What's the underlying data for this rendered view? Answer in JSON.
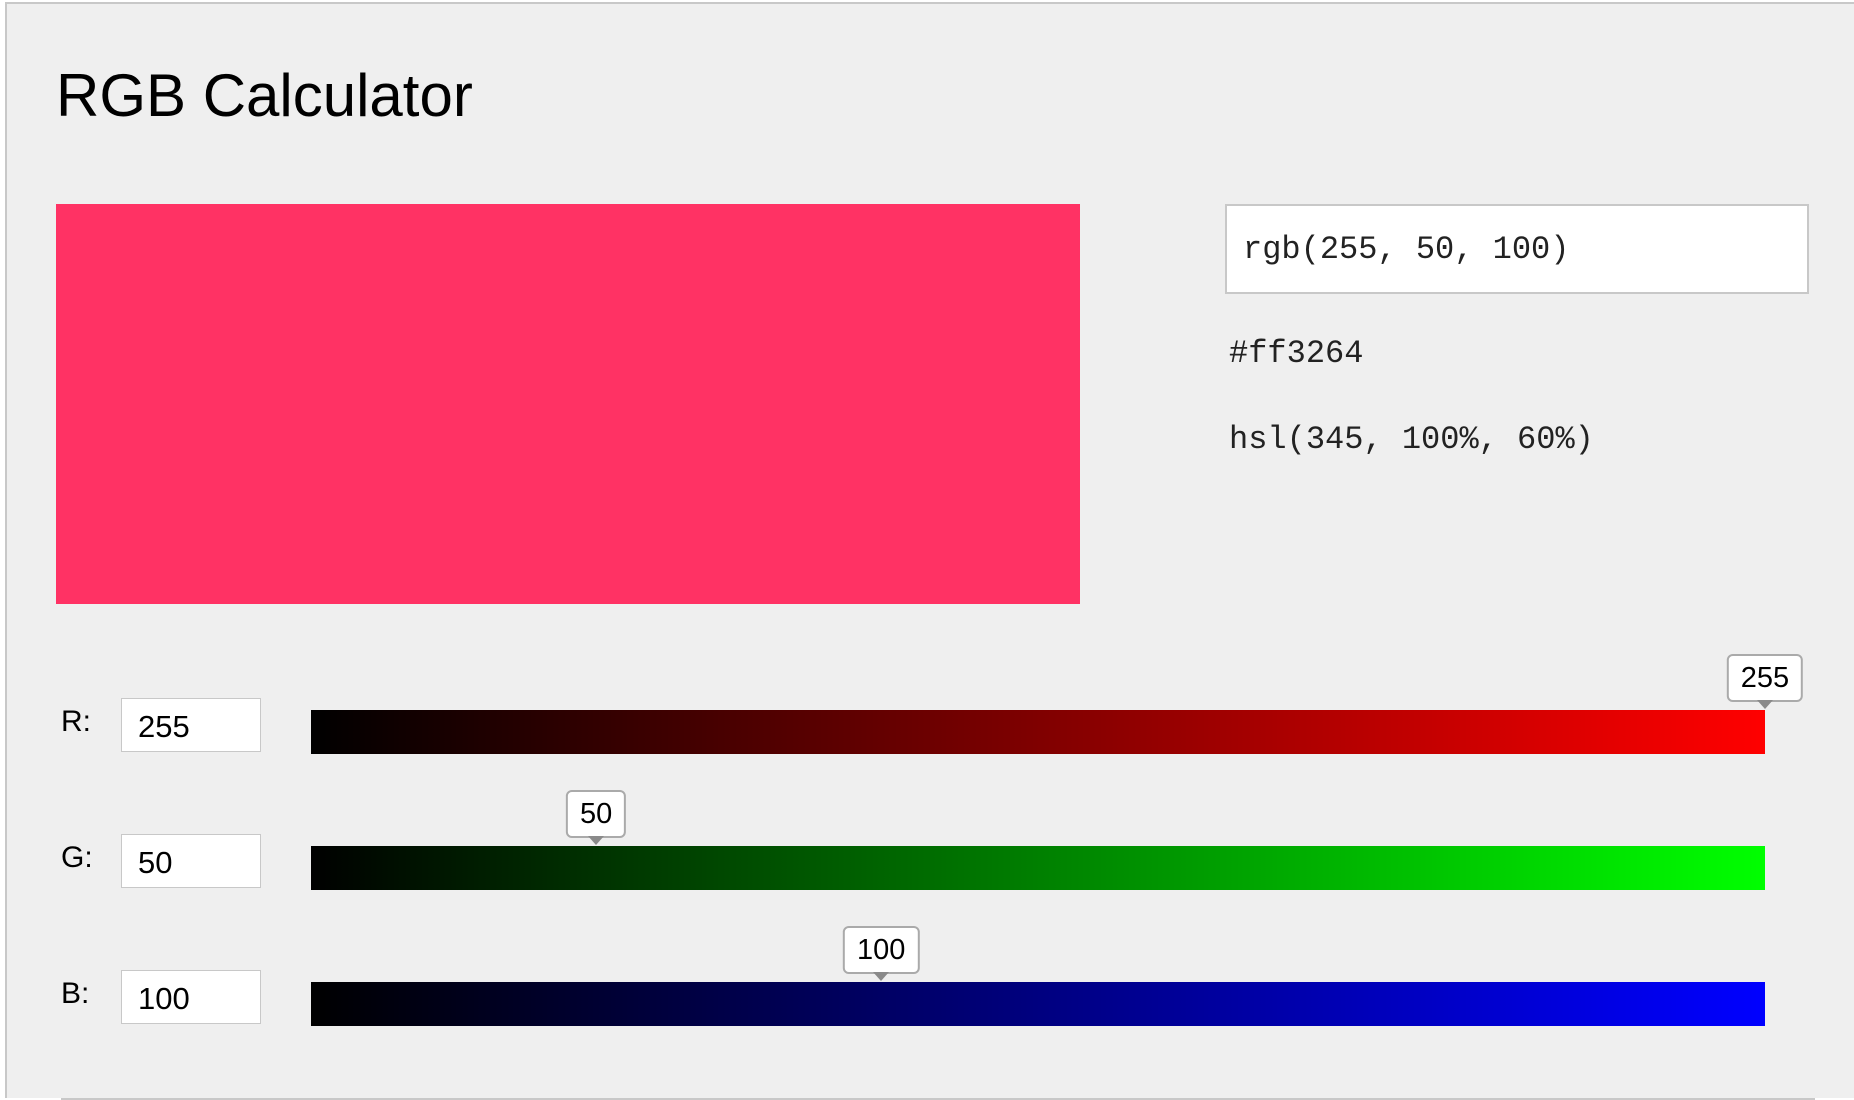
{
  "page": {
    "title": "RGB Calculator"
  },
  "preview": {
    "color": "#ff3264"
  },
  "outputs": {
    "rgb": "rgb(255, 50, 100)",
    "hex": "#ff3264",
    "hsl": "hsl(345, 100%, 60%)"
  },
  "channels": [
    {
      "label": "R:",
      "value": "255",
      "gradient_to": "#ff0000"
    },
    {
      "label": "G:",
      "value": "50",
      "gradient_to": "#00ff00"
    },
    {
      "label": "B:",
      "value": "100",
      "gradient_to": "#0000ff"
    }
  ],
  "slider_max": 255,
  "colors": {
    "panel_bg": "#efefef",
    "border": "#c8c8c8"
  }
}
